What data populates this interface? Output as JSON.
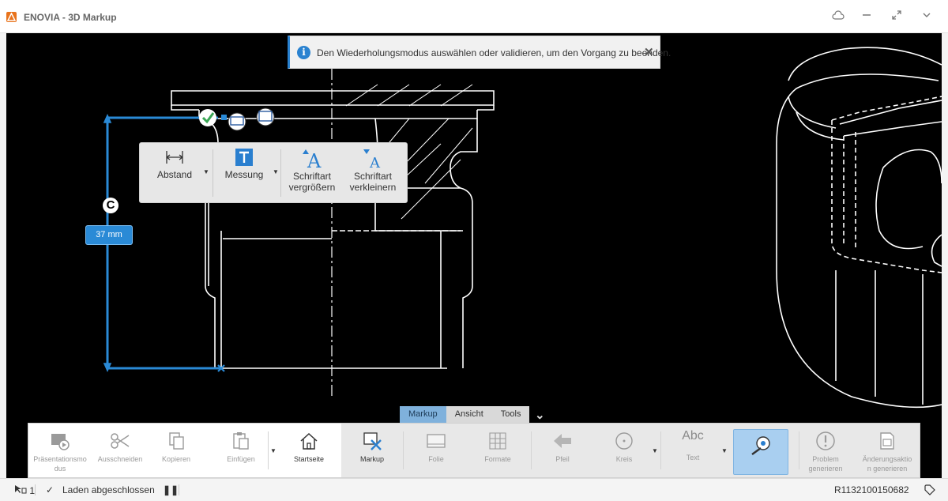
{
  "window": {
    "title": "ENOVIA - 3D Markup"
  },
  "notification": {
    "message": "Den Wiederholungsmodus auswählen oder validieren, um den Vorgang zu beenden."
  },
  "context_toolbar": {
    "items": [
      {
        "label": "Abstand"
      },
      {
        "label": "Messung"
      },
      {
        "label_line1": "Schriftart",
        "label_line2": "vergrößern"
      },
      {
        "label_line1": "Schriftart",
        "label_line2": "verkleinern"
      }
    ]
  },
  "dimension": {
    "value": "37 mm",
    "symbol": "C"
  },
  "ribbon_tabs": [
    {
      "label": "Markup",
      "active": true
    },
    {
      "label": "Ansicht",
      "active": false
    },
    {
      "label": "Tools",
      "active": false
    }
  ],
  "ribbon": {
    "presentation_l1": "Präsentationsmo",
    "presentation_l2": "dus",
    "cut": "Ausschneiden",
    "copy": "Kopieren",
    "paste": "Einfügen",
    "home": "Startseite",
    "markup": "Markup",
    "slide": "Folie",
    "formats": "Formate",
    "arrow": "Pfeil",
    "circle": "Kreis",
    "text": "Text",
    "text_icon": "Abc",
    "problem_l1": "Problem",
    "problem_l2": "generieren",
    "change_l1": "Änderungsaktio",
    "change_l2": "n generieren"
  },
  "status": {
    "selection_count": "1",
    "load_message": "Laden abgeschlossen",
    "object_id": "R1132100150682"
  },
  "colors": {
    "accent": "#2a8ad6",
    "canvas_bg": "#000000",
    "selection": "#1e90ff"
  }
}
